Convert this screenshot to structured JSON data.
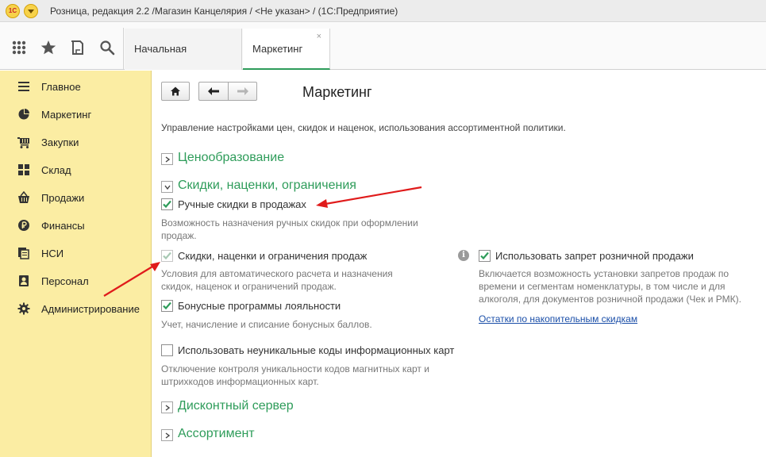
{
  "window": {
    "logo_text": "1С",
    "title": "Розница, редакция 2.2 /Магазин Канцелярия / <Не указан> /  (1С:Предприятие)"
  },
  "toolbar": {
    "tools": [
      "apps-grid-icon",
      "star-icon",
      "history-icon",
      "search-icon"
    ]
  },
  "tabs": [
    {
      "label": "Начальная страница",
      "active": false
    },
    {
      "label": "Маркетинг",
      "active": true,
      "close": "×"
    }
  ],
  "sidebar": {
    "items": [
      {
        "label": "Главное",
        "icon": "menu-lines-icon"
      },
      {
        "label": "Маркетинг",
        "icon": "pie-chart-icon"
      },
      {
        "label": "Закупки",
        "icon": "cart-icon"
      },
      {
        "label": "Склад",
        "icon": "warehouse-grid-icon"
      },
      {
        "label": "Продажи",
        "icon": "basket-icon"
      },
      {
        "label": "Финансы",
        "icon": "ruble-coin-icon"
      },
      {
        "label": "НСИ",
        "icon": "documents-icon"
      },
      {
        "label": "Персонал",
        "icon": "person-icon"
      },
      {
        "label": "Администрирование",
        "icon": "gear-icon"
      }
    ]
  },
  "main": {
    "title": "Маркетинг",
    "description": "Управление настройками цен, скидок и наценок, использования ассортиментной политики.",
    "groups": {
      "pricing": "Ценообразование",
      "discounts": "Скидки, наценки, ограничения",
      "discount_server": "Дисконтный сервер",
      "assortment": "Ассортимент"
    },
    "options": {
      "manual_discounts": {
        "label": "Ручные скидки в продажах",
        "checked": true,
        "hint_line1": "Возможность назначения ручных скидок при оформлении",
        "hint_line2": "продаж."
      },
      "auto_discounts": {
        "label": "Скидки, наценки и ограничения продаж",
        "checked": true,
        "disabled": true,
        "hint_line1": "Условия для автоматического расчета и назначения",
        "hint_line2": "скидок, наценок и ограничений продаж."
      },
      "bonus_programs": {
        "label": "Бонусные программы лояльности",
        "checked": true,
        "hint": "Учет, начисление и списание бонусных баллов."
      },
      "nonunique_codes": {
        "label": "Использовать неуникальные коды информационных карт",
        "checked": false,
        "hint_line1": "Отключение контроля уникальности кодов магнитных карт и",
        "hint_line2": "штрихкодов информационных карт."
      },
      "retail_ban": {
        "label": "Использовать запрет розничной продажи",
        "checked": true,
        "hint_line1": "Включается возможность установки запретов продаж по",
        "hint_line2": "времени и сегментам номенклатуры, в том числе и для",
        "hint_line3": "алкоголя, для документов розничной продажи (Чек и РМК)."
      }
    },
    "info_glyph": "i",
    "link_cumulative": "Остатки по накопительным скидкам"
  },
  "colors": {
    "sidebar_bg": "#fbeda3",
    "group_green": "#2e9c5a",
    "annotation_red": "#e01b1b",
    "link_blue": "#1a4ea8"
  }
}
